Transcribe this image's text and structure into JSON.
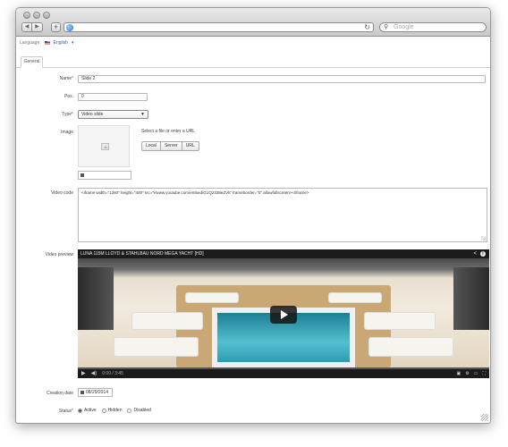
{
  "browser": {
    "search_placeholder": "Google"
  },
  "language": {
    "label": "Language:",
    "value": "English"
  },
  "tabs": [
    {
      "label": "General"
    }
  ],
  "form": {
    "name": {
      "label": "Name",
      "value": "Slide 2"
    },
    "pos": {
      "label": "Pos.",
      "value": "0"
    },
    "type": {
      "label": "Type",
      "value": "Video slide"
    },
    "image": {
      "label": "Image",
      "hint": "Select a file or enter a URL",
      "buttons": [
        "Local",
        "Server",
        "URL"
      ]
    },
    "video_code": {
      "label": "Video code",
      "value": "<iframe width=\"1280\" height=\"400\" src=\"//www.youtube.com/embed/G1Q2338eZVk\" frameborder=\"0\" allowfullscreen></iframe>"
    },
    "video_preview": {
      "label": "Video preview",
      "title": "LUNA 115M LLOYD & STAHLBAU NORD MEGA YACHT [HD]",
      "time": "0:00 / 3:45",
      "progress": 0.0
    },
    "creation_date": {
      "label": "Creation date",
      "value": "08/29/2014"
    },
    "status": {
      "label": "Status",
      "options": [
        "Active",
        "Hidden",
        "Disabled"
      ],
      "selected": "Active"
    }
  },
  "colors": {
    "required_marker": "#cc3333",
    "link_blue": "#2a5fa8"
  }
}
